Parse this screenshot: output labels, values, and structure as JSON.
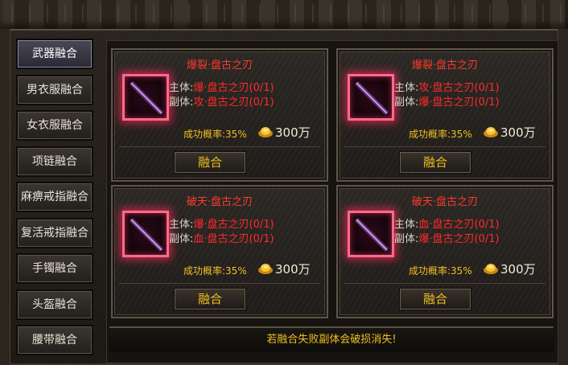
{
  "tabs": [
    {
      "label": "武器融合",
      "active": true
    },
    {
      "label": "男衣服融合",
      "active": false
    },
    {
      "label": "女衣服融合",
      "active": false
    },
    {
      "label": "项链融合",
      "active": false
    },
    {
      "label": "麻痹戒指融合",
      "active": false
    },
    {
      "label": "复活戒指融合",
      "active": false
    },
    {
      "label": "手镯融合",
      "active": false
    },
    {
      "label": "头盔融合",
      "active": false
    },
    {
      "label": "腰带融合",
      "active": false
    }
  ],
  "cards": [
    {
      "title": "爆裂·盘古之刃",
      "main_label": "主体:",
      "main_value": "爆·盘古之刃(0/1)",
      "sub_label": "副体:",
      "sub_value": "攻·盘古之刃(0/1)",
      "rate": "成功概率:35%",
      "cost": "300万",
      "button": "融合"
    },
    {
      "title": "爆裂·盘古之刃",
      "main_label": "主体:",
      "main_value": "攻·盘古之刃(0/1)",
      "sub_label": "副体:",
      "sub_value": "爆·盘古之刃(0/1)",
      "rate": "成功概率:35%",
      "cost": "300万",
      "button": "融合"
    },
    {
      "title": "破天·盘古之刃",
      "main_label": "主体:",
      "main_value": "爆·盘古之刃(0/1)",
      "sub_label": "副体:",
      "sub_value": "血·盘古之刃(0/1)",
      "rate": "成功概率:35%",
      "cost": "300万",
      "button": "融合"
    },
    {
      "title": "破天·盘古之刃",
      "main_label": "主体:",
      "main_value": "血·盘古之刃(0/1)",
      "sub_label": "副体:",
      "sub_value": "爆·盘古之刃(0/1)",
      "rate": "成功概率:35%",
      "cost": "300万",
      "button": "融合"
    }
  ],
  "notice": "若融合失败副体会破损消失!",
  "colors": {
    "accent_red": "#ff2a2a",
    "gold": "#f0c020"
  },
  "icons": {
    "slot": "sword-icon",
    "cost": "gold-ingot-icon"
  }
}
